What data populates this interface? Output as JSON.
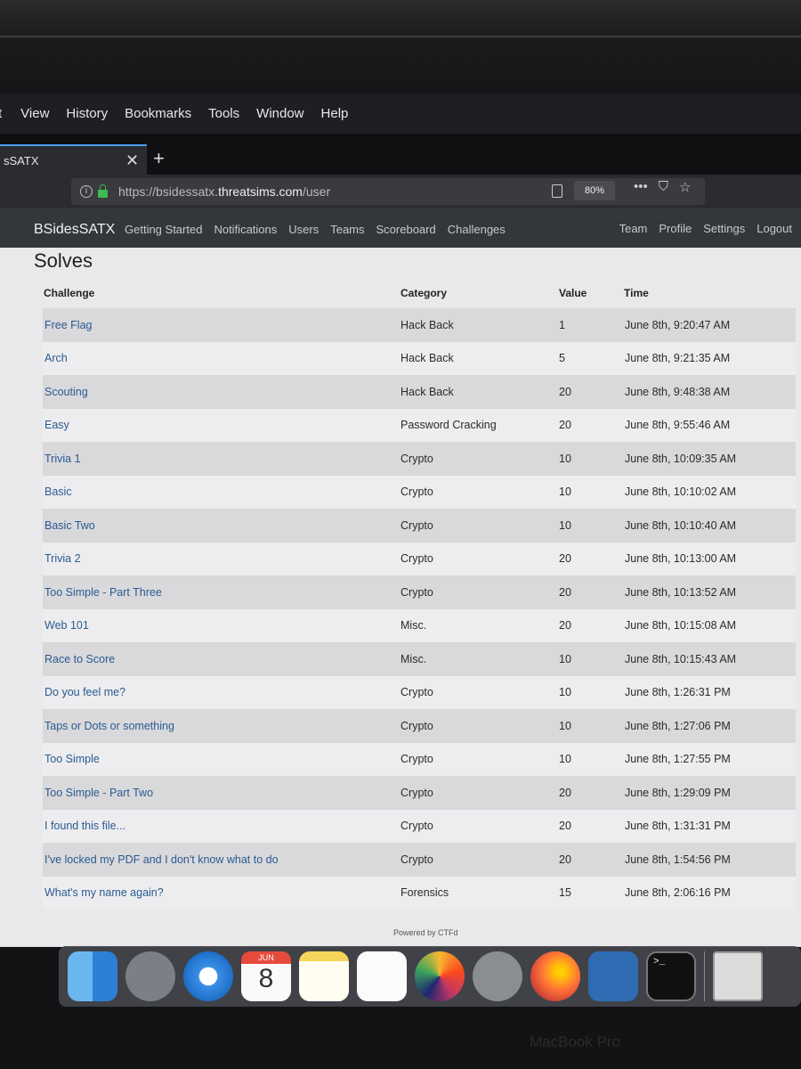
{
  "menubar": {
    "items": [
      "t",
      "View",
      "History",
      "Bookmarks",
      "Tools",
      "Window",
      "Help"
    ]
  },
  "browser": {
    "tab_title": "sSATX",
    "tab_close": "✕",
    "new_tab": "+",
    "url_prefix": "https://bsidessatx.",
    "url_domain": "threatsims.com",
    "url_path": "/user",
    "zoom": "80%",
    "icons": [
      "reader-view-icon",
      "page-actions-icon",
      "pocket-icon",
      "bookmark-star-icon"
    ]
  },
  "site": {
    "brand": "BSidesSATX",
    "nav_left": [
      "Getting Started",
      "Notifications",
      "Users",
      "Teams",
      "Scoreboard",
      "Challenges"
    ],
    "nav_right": [
      "Team",
      "Profile",
      "Settings",
      "Logout"
    ]
  },
  "solves": {
    "title": "Solves",
    "headers": {
      "challenge": "Challenge",
      "category": "Category",
      "value": "Value",
      "time": "Time"
    },
    "rows": [
      {
        "name": "Free Flag",
        "category": "Hack Back",
        "value": "1",
        "time": "June 8th, 9:20:47 AM"
      },
      {
        "name": "Arch",
        "category": "Hack Back",
        "value": "5",
        "time": "June 8th, 9:21:35 AM"
      },
      {
        "name": "Scouting",
        "category": "Hack Back",
        "value": "20",
        "time": "June 8th, 9:48:38 AM"
      },
      {
        "name": "Easy",
        "category": "Password Cracking",
        "value": "20",
        "time": "June 8th, 9:55:46 AM"
      },
      {
        "name": "Trivia 1",
        "category": "Crypto",
        "value": "10",
        "time": "June 8th, 10:09:35 AM"
      },
      {
        "name": "Basic",
        "category": "Crypto",
        "value": "10",
        "time": "June 8th, 10:10:02 AM"
      },
      {
        "name": "Basic Two",
        "category": "Crypto",
        "value": "10",
        "time": "June 8th, 10:10:40 AM"
      },
      {
        "name": "Trivia 2",
        "category": "Crypto",
        "value": "20",
        "time": "June 8th, 10:13:00 AM"
      },
      {
        "name": "Too Simple - Part Three",
        "category": "Crypto",
        "value": "20",
        "time": "June 8th, 10:13:52 AM"
      },
      {
        "name": "Web 101",
        "category": "Misc.",
        "value": "20",
        "time": "June 8th, 10:15:08 AM"
      },
      {
        "name": "Race to Score",
        "category": "Misc.",
        "value": "10",
        "time": "June 8th, 10:15:43 AM"
      },
      {
        "name": "Do you feel me?",
        "category": "Crypto",
        "value": "10",
        "time": "June 8th, 1:26:31 PM"
      },
      {
        "name": "Taps or Dots or something",
        "category": "Crypto",
        "value": "10",
        "time": "June 8th, 1:27:06 PM"
      },
      {
        "name": "Too Simple",
        "category": "Crypto",
        "value": "10",
        "time": "June 8th, 1:27:55 PM"
      },
      {
        "name": "Too Simple - Part Two",
        "category": "Crypto",
        "value": "20",
        "time": "June 8th, 1:29:09 PM"
      },
      {
        "name": "I found this file...",
        "category": "Crypto",
        "value": "20",
        "time": "June 8th, 1:31:31 PM"
      },
      {
        "name": "I've locked my PDF and I don't know what to do",
        "category": "Crypto",
        "value": "20",
        "time": "June 8th, 1:54:56 PM"
      },
      {
        "name": "What's my name again?",
        "category": "Forensics",
        "value": "15",
        "time": "June 8th, 2:06:16 PM"
      }
    ],
    "footer": "Powered by CTFd"
  },
  "dock": {
    "calendar_month": "JUN",
    "calendar_day": "8",
    "apps": [
      "finder-icon",
      "launchpad-icon",
      "safari-icon",
      "calendar-icon",
      "notes-icon",
      "reminders-icon",
      "photos-icon",
      "system-preferences-icon",
      "firefox-icon",
      "virtualbox-icon",
      "terminal-icon",
      "preview-icon"
    ]
  },
  "hardware_label": "MacBook Pro"
}
